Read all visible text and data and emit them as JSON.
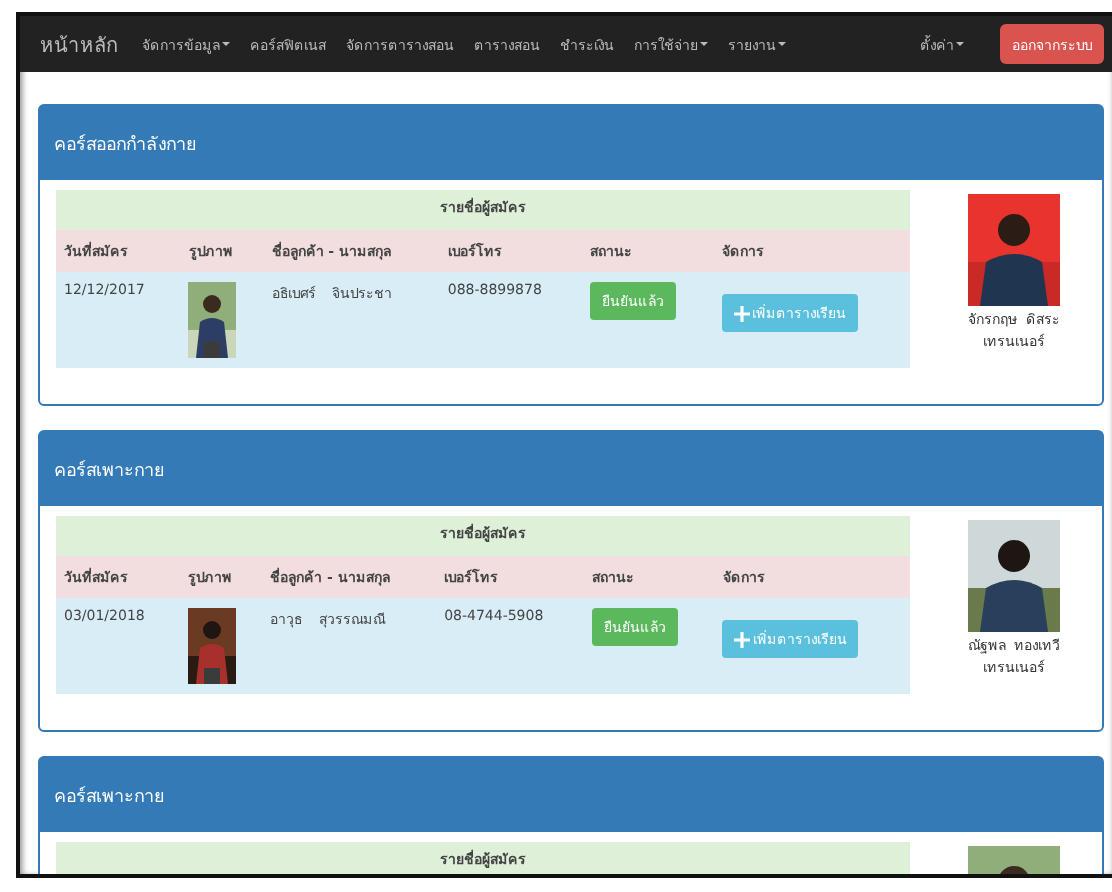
{
  "navbar": {
    "brand": "หน้าหลัก",
    "items": [
      {
        "label": "จัดการข้อมูล",
        "dropdown": true
      },
      {
        "label": "คอร์สฟิตเนส",
        "dropdown": false
      },
      {
        "label": "จัดการตารางสอน",
        "dropdown": false
      },
      {
        "label": "ตารางสอน",
        "dropdown": false
      },
      {
        "label": "ชำระเงิน",
        "dropdown": false
      },
      {
        "label": "การใช้จ่าย",
        "dropdown": true
      },
      {
        "label": "รายงาน",
        "dropdown": true
      }
    ],
    "right_items": [
      {
        "label": "ตั้งค่า",
        "dropdown": true
      }
    ],
    "logout_button": "ออกจากระบบ"
  },
  "courses": [
    {
      "title": "คอร์สออกกำลังกาย",
      "table_caption": "รายชื่อผู้สมัคร",
      "columns": [
        "วันที่สมัคร",
        "รูปภาพ",
        "ชื่อลูกค้า - นามสกุล",
        "เบอร์โทร",
        "สถานะ",
        "จัดการ"
      ],
      "rows": [
        {
          "date": "12/12/2017",
          "first_name": "อธิเบศร์",
          "last_name": "จินประชา",
          "phone": "088-8899878",
          "status": "ยืนยันแล้ว",
          "action": "เพิ่มตารางเรียน"
        }
      ],
      "trainer": {
        "first_name": "จักรกฤษ",
        "last_name": "ดิสระ",
        "role": "เทรนเนอร์"
      }
    },
    {
      "title": "คอร์สเพาะกาย",
      "table_caption": "รายชื่อผู้สมัคร",
      "columns": [
        "วันที่สมัคร",
        "รูปภาพ",
        "ชื่อลูกค้า - นามสกุล",
        "เบอร์โทร",
        "สถานะ",
        "จัดการ"
      ],
      "rows": [
        {
          "date": "03/01/2018",
          "first_name": "อาวุธ",
          "last_name": "สุวรรณมณี",
          "phone": "08-4744-5908",
          "status": "ยืนยันแล้ว",
          "action": "เพิ่มตารางเรียน"
        }
      ],
      "trainer": {
        "first_name": "ณัฐพล",
        "last_name": "ทองเทวี",
        "role": "เทรนเนอร์"
      }
    },
    {
      "title": "คอร์สเพาะกาย",
      "table_caption": "รายชื่อผู้สมัคร"
    }
  ]
}
